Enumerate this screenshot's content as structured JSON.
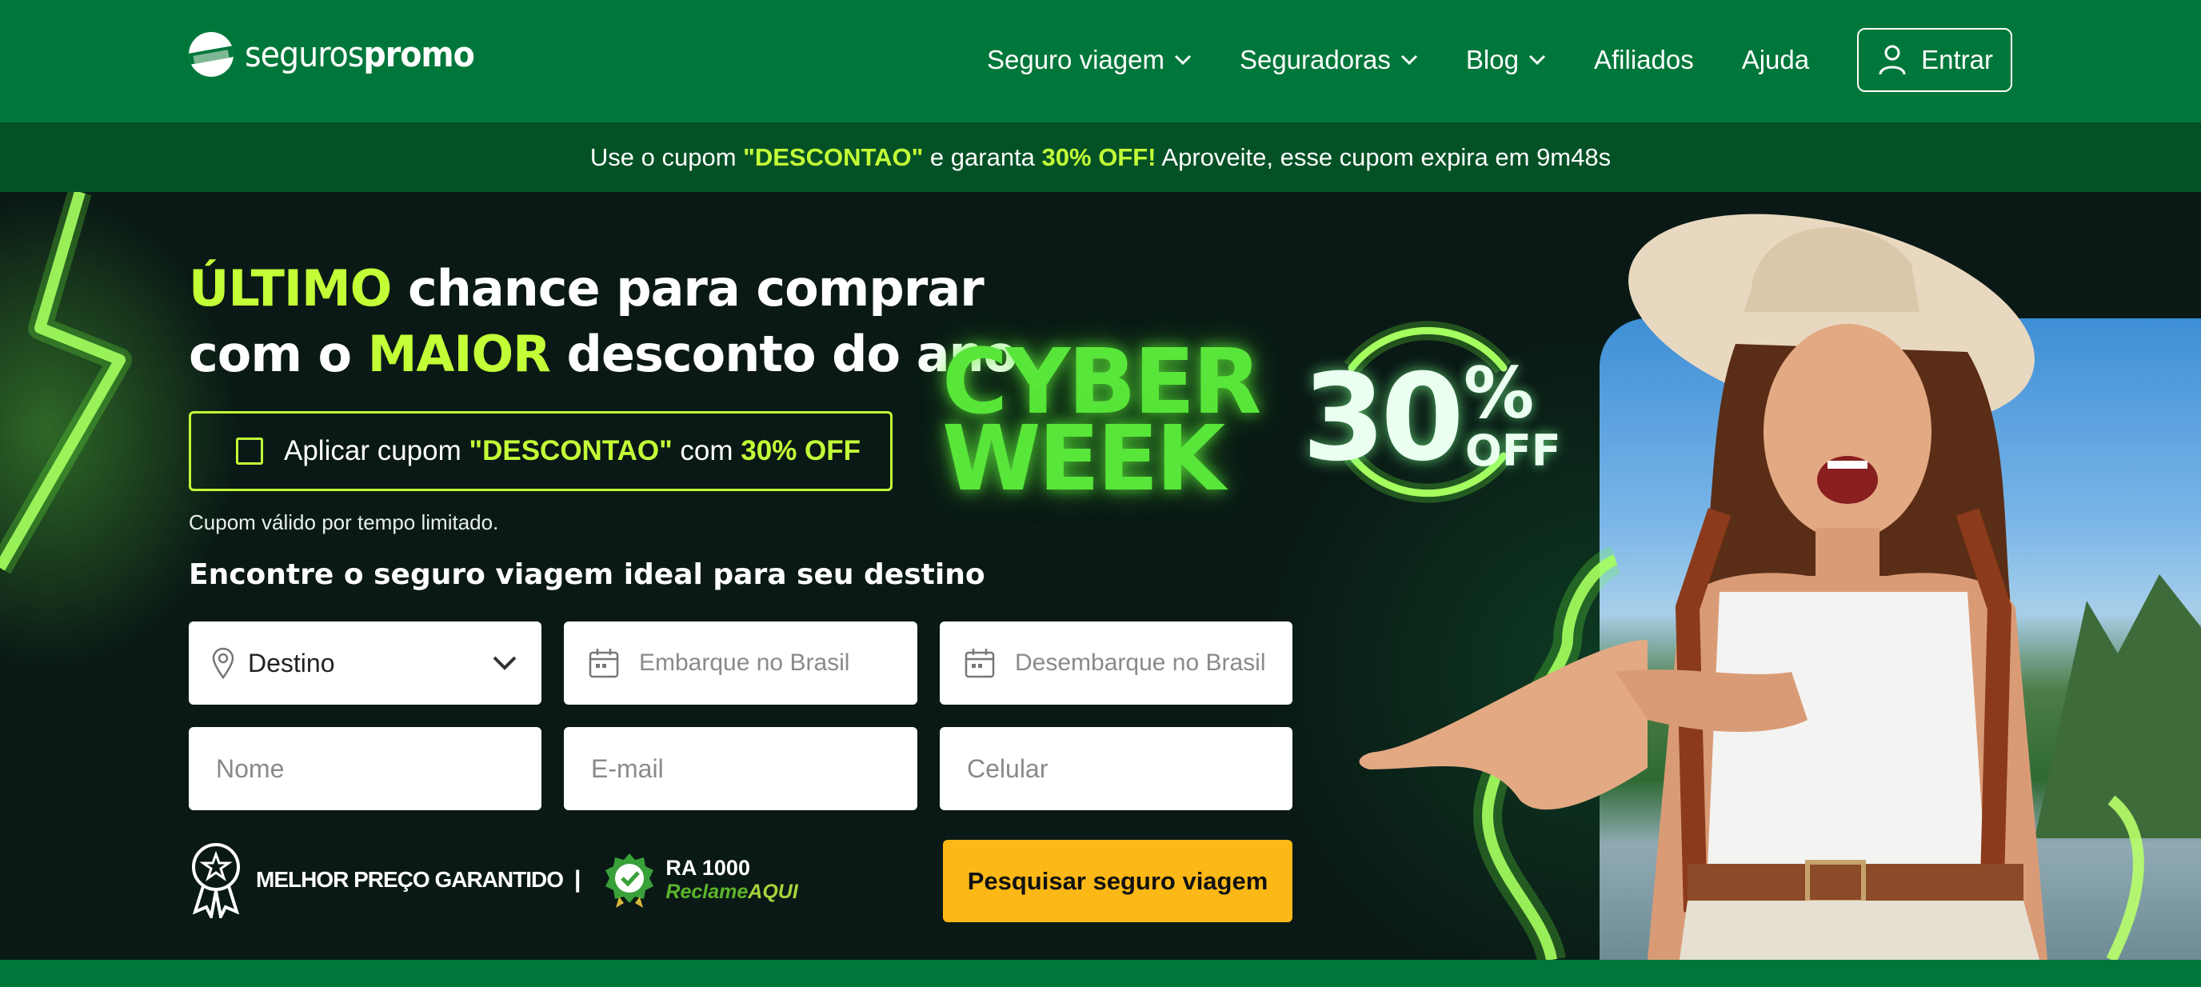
{
  "header": {
    "logo": {
      "part1": "seguros",
      "part2": "promo"
    },
    "nav": [
      {
        "label": "Seguro viagem",
        "dropdown": true
      },
      {
        "label": "Seguradoras",
        "dropdown": true
      },
      {
        "label": "Blog",
        "dropdown": true
      },
      {
        "label": "Afiliados",
        "dropdown": false
      },
      {
        "label": "Ajuda",
        "dropdown": false
      }
    ],
    "login_label": "Entrar",
    "login_icon": "user-icon"
  },
  "coupon_bar": {
    "text1": "Use o cupom ",
    "code": "\"DESCONTAO\"",
    "text2": " e garanta ",
    "discount": "30% OFF!",
    "text3": " Aproveite, esse cupom expira em 9m48s"
  },
  "hero": {
    "headline": {
      "w1": "ÚLTIMO",
      "w2": " chance para comprar",
      "w3": "com o ",
      "w4": "MAIOR",
      "w5": " desconto do ano"
    },
    "coupon_checkbox": {
      "t1": "Aplicar cupom ",
      "code": "\"DESCONTAO\"",
      "t2": " com ",
      "discount": "30% OFF",
      "checked": false
    },
    "coupon_note": "Cupom válido por tempo limitado.",
    "form_title": "Encontre o seguro viagem ideal para seu destino",
    "form": {
      "destination": {
        "value": "Destino",
        "icon": "location-pin-icon"
      },
      "departure": {
        "placeholder": "Embarque no Brasil",
        "icon": "calendar-icon"
      },
      "arrival": {
        "placeholder": "Desembarque no Brasil",
        "icon": "calendar-icon"
      },
      "name": {
        "placeholder": "Nome"
      },
      "email": {
        "placeholder": "E-mail"
      },
      "phone": {
        "placeholder": "Celular"
      },
      "submit_label": "Pesquisar seguro viagem"
    },
    "badges": {
      "best_price": "MELHOR PREÇO GARANTIDO",
      "separator": "|",
      "ra_score": "RA 1000",
      "ra_brand1": "Reclame",
      "ra_brand2": "AQUI"
    },
    "promo": {
      "line1": "CYBER",
      "line2": "WEEK",
      "percent": "30",
      "percent_sign": "%",
      "off": "OFF"
    }
  },
  "colors": {
    "brand_green": "#00773a",
    "dark_green": "#045126",
    "accent_lime": "#c3ff37",
    "cta_yellow": "#fcb817",
    "hero_bg": "#0a1915"
  }
}
